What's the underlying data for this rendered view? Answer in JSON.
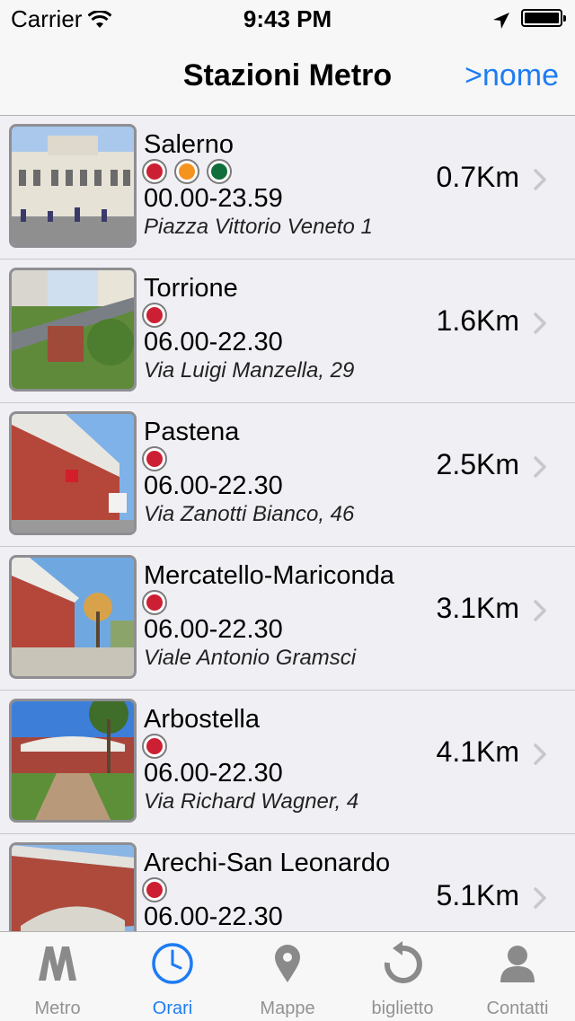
{
  "status_bar": {
    "carrier": "Carrier",
    "time": "9:43 PM"
  },
  "nav": {
    "title": "Stazioni Metro",
    "right_button": ">nome"
  },
  "line_colors": {
    "red": "#cc1f33",
    "orange": "#f5931f",
    "green": "#0f6e3a"
  },
  "stations": [
    {
      "name": "Salerno",
      "lines": [
        "red",
        "orange",
        "green"
      ],
      "hours": "00.00-23.59",
      "address": "Piazza Vittorio Veneto 1",
      "distance": "0.7Km"
    },
    {
      "name": "Torrione",
      "lines": [
        "red"
      ],
      "hours": "06.00-22.30",
      "address": "Via Luigi Manzella, 29",
      "distance": "1.6Km"
    },
    {
      "name": "Pastena",
      "lines": [
        "red"
      ],
      "hours": "06.00-22.30",
      "address": "Via Zanotti Bianco, 46",
      "distance": "2.5Km"
    },
    {
      "name": "Mercatello-Mariconda",
      "lines": [
        "red"
      ],
      "hours": "06.00-22.30",
      "address": "Viale Antonio Gramsci",
      "distance": "3.1Km"
    },
    {
      "name": "Arbostella",
      "lines": [
        "red"
      ],
      "hours": "06.00-22.30",
      "address": "Via Richard Wagner, 4",
      "distance": "4.1Km"
    },
    {
      "name": "Arechi-San Leonardo",
      "lines": [
        "red"
      ],
      "hours": "06.00-22.30",
      "address": "",
      "distance": "5.1Km"
    }
  ],
  "tabs": [
    {
      "label": "Metro",
      "icon": "metro-m-icon",
      "active": false
    },
    {
      "label": "Orari",
      "icon": "clock-icon",
      "active": true
    },
    {
      "label": "Mappe",
      "icon": "map-pin-icon",
      "active": false
    },
    {
      "label": "biglietto",
      "icon": "refresh-icon",
      "active": false
    },
    {
      "label": "Contatti",
      "icon": "contact-person-icon",
      "active": false
    }
  ],
  "colors": {
    "accent": "#1e7cf2",
    "inactive_tab": "#929292"
  }
}
